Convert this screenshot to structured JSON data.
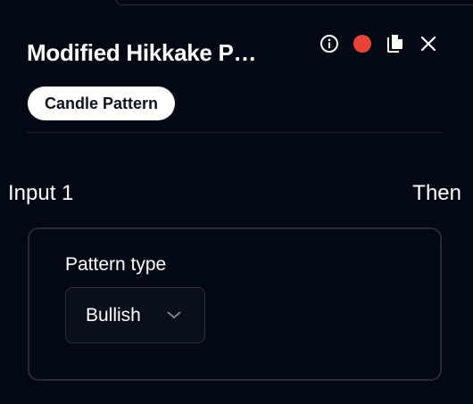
{
  "panel": {
    "title": "Modified Hikkake P…",
    "tag": "Candle Pattern",
    "status_color": "#e8443a",
    "icons": [
      "info-icon",
      "status-dot",
      "copy-icon",
      "close-icon"
    ]
  },
  "flow": {
    "input_label": "Input 1",
    "then_label": "Then"
  },
  "pattern": {
    "label": "Pattern type",
    "value": "Bullish"
  }
}
